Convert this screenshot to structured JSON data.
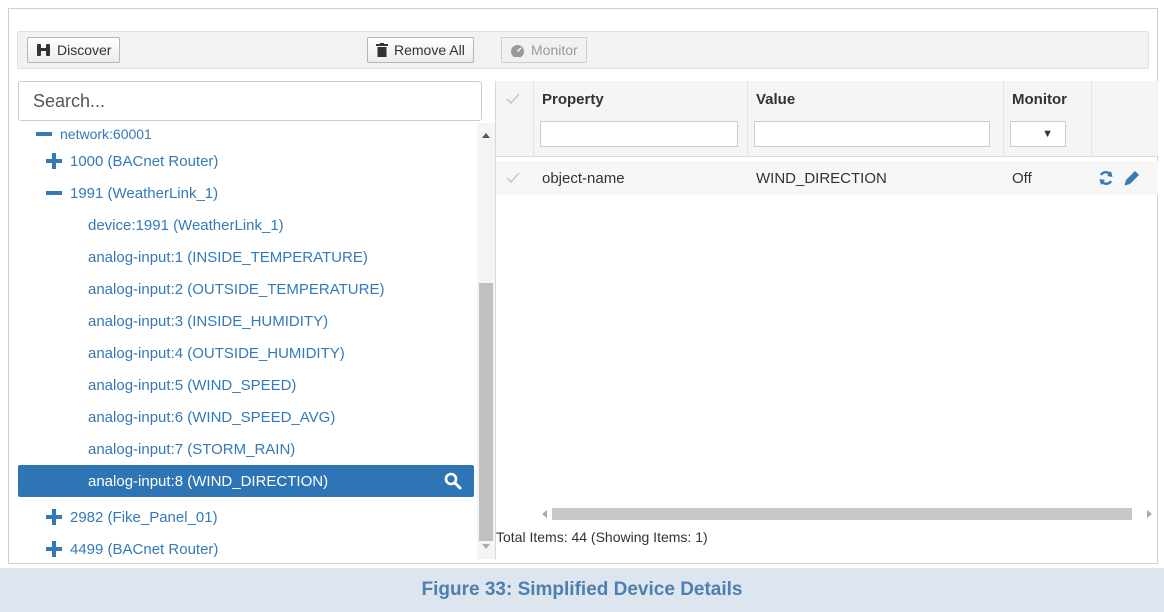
{
  "toolbar": {
    "discover_label": "Discover",
    "remove_all_label": "Remove All",
    "monitor_label": "Monitor"
  },
  "search": {
    "placeholder": "Search..."
  },
  "tree": {
    "nodes": [
      {
        "label": "network:60001",
        "icon": "minus-icon",
        "level": 0
      },
      {
        "label": "1000 (BACnet Router)",
        "icon": "plus-icon",
        "level": 1
      },
      {
        "label": "1991 (WeatherLink_1)",
        "icon": "minus-icon",
        "level": 1
      },
      {
        "label": "device:1991 (WeatherLink_1)",
        "icon": "",
        "level": 2
      },
      {
        "label": "analog-input:1 (INSIDE_TEMPERATURE)",
        "icon": "",
        "level": 2
      },
      {
        "label": "analog-input:2 (OUTSIDE_TEMPERATURE)",
        "icon": "",
        "level": 2
      },
      {
        "label": "analog-input:3 (INSIDE_HUMIDITY)",
        "icon": "",
        "level": 2
      },
      {
        "label": "analog-input:4 (OUTSIDE_HUMIDITY)",
        "icon": "",
        "level": 2
      },
      {
        "label": "analog-input:5 (WIND_SPEED)",
        "icon": "",
        "level": 2
      },
      {
        "label": "analog-input:6 (WIND_SPEED_AVG)",
        "icon": "",
        "level": 2
      },
      {
        "label": "analog-input:7 (STORM_RAIN)",
        "icon": "",
        "level": 2
      },
      {
        "label": "analog-input:8 (WIND_DIRECTION)",
        "icon": "",
        "level": 2,
        "selected": true
      },
      {
        "label": "2982 (Fike_Panel_01)",
        "icon": "plus-icon",
        "level": 1
      },
      {
        "label": "4499 (BACnet Router)",
        "icon": "plus-icon",
        "level": 1
      }
    ]
  },
  "grid": {
    "columns": {
      "property": "Property",
      "value": "Value",
      "monitor": "Monitor"
    },
    "rows": [
      {
        "property": "object-name",
        "value": "WIND_DIRECTION",
        "monitor": "Off"
      }
    ],
    "total_text": "Total Items: 44 (Showing Items: 1)"
  },
  "caption": "Figure 33: Simplified Device Details",
  "colors": {
    "accent": "#337ab7",
    "selected_bg": "#2e75b6",
    "caption_bg": "#dde6ee",
    "caption_text": "#4d7fb0"
  }
}
